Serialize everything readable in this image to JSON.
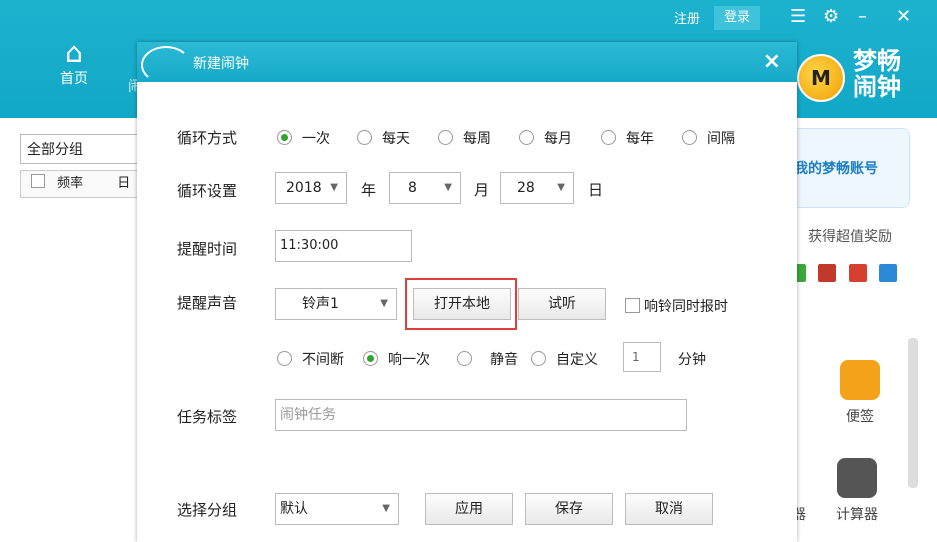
{
  "header": {
    "register": "注册",
    "login": "登录",
    "home_label": "首页",
    "nav2_fragment": "闹",
    "logo_text_line1": "梦畅",
    "logo_text_line2": "闹钟",
    "logo_badge": "M"
  },
  "left_panel": {
    "group_select": "全部分组",
    "col_frequency": "频率",
    "col_second": "日"
  },
  "right_panel": {
    "account_link": "我的梦畅账号",
    "reward": "获得超值奖励",
    "apps": [
      {
        "label": "便签"
      },
      {
        "label": "计算器"
      },
      {
        "label": "算器"
      }
    ]
  },
  "dialog": {
    "title": "新建闹钟",
    "cycle_mode": {
      "label": "循环方式",
      "options": [
        "一次",
        "每天",
        "每周",
        "每月",
        "每年",
        "间隔"
      ],
      "selected": "一次"
    },
    "cycle_setting": {
      "label": "循环设置",
      "year": "2018",
      "year_unit": "年",
      "month": "8",
      "month_unit": "月",
      "day": "28",
      "day_unit": "日"
    },
    "remind_time": {
      "label": "提醒时间",
      "value": "11:30:00"
    },
    "sound": {
      "label": "提醒声音",
      "selected": "铃声1",
      "open_local": "打开本地",
      "preview": "试听",
      "announce_time": "响铃同时报时",
      "play_options": [
        "不间断",
        "响一次",
        "静音",
        "自定义"
      ],
      "play_selected": "响一次",
      "custom_minutes": "1",
      "minutes_unit": "分钟"
    },
    "task_tag": {
      "label": "任务标签",
      "placeholder": "闹钟任务"
    },
    "group": {
      "label": "选择分组",
      "selected": "默认",
      "apply": "应用",
      "save": "保存",
      "cancel": "取消"
    }
  },
  "colors": {
    "titlebar": "#16a9c8",
    "highlight": "#d9413a",
    "radio_on": "#2ea52e"
  }
}
